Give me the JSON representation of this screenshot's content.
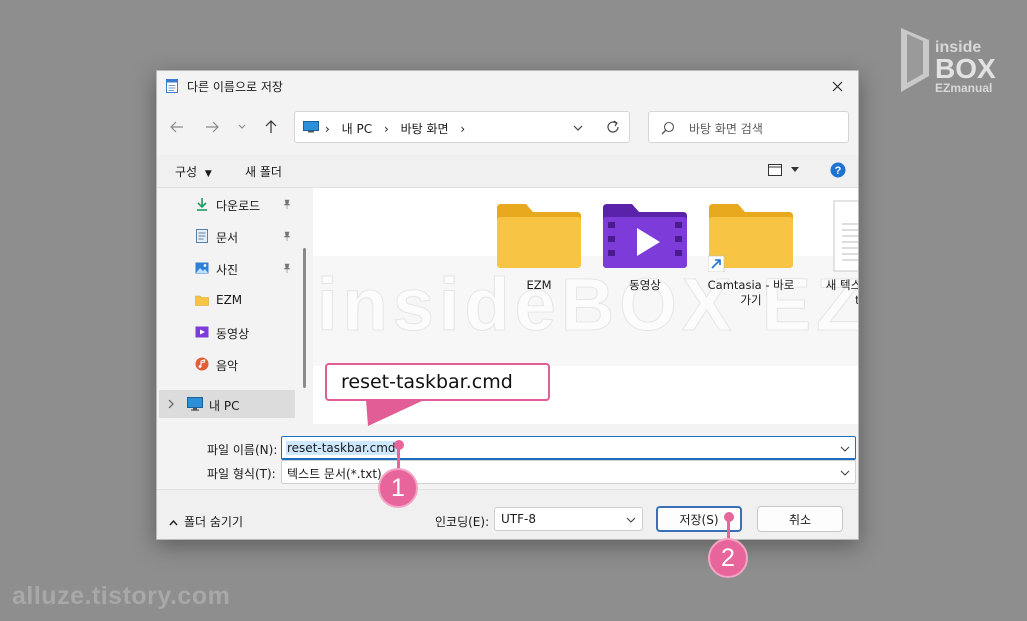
{
  "dialog": {
    "title": "다른 이름으로 저장",
    "breadcrumb": [
      "내 PC",
      "바탕 화면"
    ],
    "search_placeholder": "바탕 화면 검색",
    "toolbar": {
      "organize": "구성",
      "new_folder": "새 폴더"
    },
    "sidebar": [
      {
        "label": "다운로드",
        "icon": "download-icon",
        "pinned": true
      },
      {
        "label": "문서",
        "icon": "document-icon",
        "pinned": true
      },
      {
        "label": "사진",
        "icon": "picture-icon",
        "pinned": true
      },
      {
        "label": "EZM",
        "icon": "folder-icon",
        "pinned": false
      },
      {
        "label": "동영상",
        "icon": "video-icon",
        "pinned": false
      },
      {
        "label": "음악",
        "icon": "music-icon",
        "pinned": false
      }
    ],
    "this_pc": "내 PC",
    "files": [
      {
        "name": "EZM",
        "type": "folder"
      },
      {
        "name": "동영상",
        "type": "video-folder"
      },
      {
        "name": "Camtasia - 바로\n가기",
        "type": "folder-shortcut"
      },
      {
        "name": "새 텍스트 문서.\ntxt",
        "type": "text-file"
      }
    ],
    "filename_label": "파일 이름(N):",
    "filename_value": "reset-taskbar.cmd",
    "filetype_label": "파일 형식(T):",
    "filetype_value": "텍스트 문서(*.txt)",
    "hide_folders": "폴더 숨기기",
    "encoding_label": "인코딩(E):",
    "encoding_value": "UTF-8",
    "save_button": "저장(S)",
    "cancel_button": "취소"
  },
  "annotation": {
    "callout_text": "reset-taskbar.cmd",
    "marker_1": "1",
    "marker_2": "2"
  },
  "overlay": {
    "watermark": "insideBOX EZmanual",
    "logo_lines": [
      "inside",
      "BOX",
      "EZmanual"
    ],
    "footer_credit": "alluze.tistory.com"
  },
  "colors": {
    "accent": "#1f6fbf",
    "marker": "#e8659c",
    "folder": "#f8c443",
    "video_folder": "#7d3bd9"
  }
}
